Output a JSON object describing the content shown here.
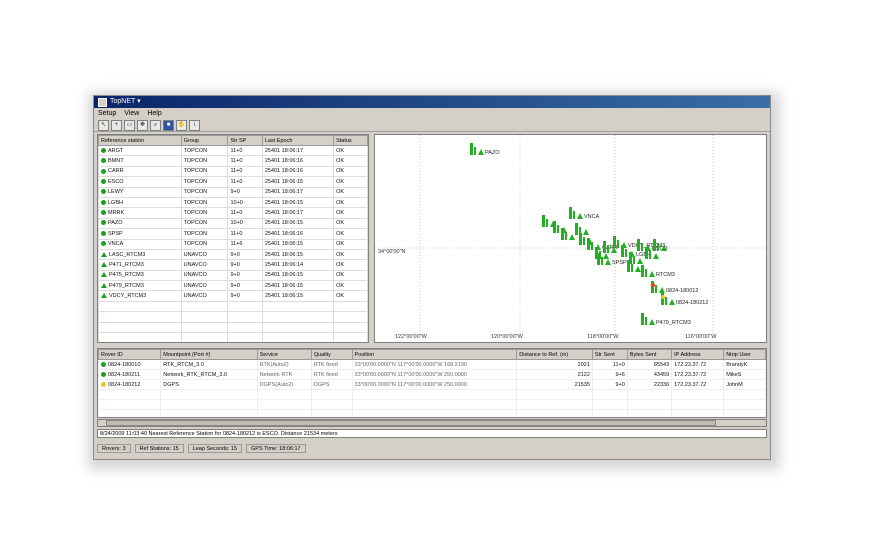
{
  "window": {
    "title": "TopNET ▾"
  },
  "menu": [
    "Setup",
    "View",
    "Help"
  ],
  "toolbar_icons": [
    "cursor-icon",
    "zoom-icon",
    "open-icon",
    "pan-icon",
    "search-icon",
    "save-icon",
    "hand-icon",
    "info-icon"
  ],
  "ref_table": {
    "columns": [
      "Reference station",
      "Group",
      "Str SP",
      "Last Epoch",
      "Status"
    ],
    "rows": [
      {
        "marker": "dot",
        "name": "ARGT",
        "group": "TOPCON",
        "sp": "11+0",
        "epoch": "25401 18:06:17",
        "status": "OK"
      },
      {
        "marker": "dot",
        "name": "BMNT",
        "group": "TOPCON",
        "sp": "11+0",
        "epoch": "25401 18:06:16",
        "status": "OK"
      },
      {
        "marker": "dot",
        "name": "CARR",
        "group": "TOPCON",
        "sp": "11+0",
        "epoch": "25401 18:06:16",
        "status": "OK"
      },
      {
        "marker": "dot",
        "name": "ESCO",
        "group": "TOPCON",
        "sp": "11+0",
        "epoch": "25401 18:06:15",
        "status": "OK"
      },
      {
        "marker": "dot",
        "name": "LEWY",
        "group": "TOPCON",
        "sp": "9+0",
        "epoch": "25401 18:06:17",
        "status": "OK"
      },
      {
        "marker": "dot",
        "name": "LGBH",
        "group": "TOPCON",
        "sp": "10+0",
        "epoch": "25401 18:06:15",
        "status": "OK"
      },
      {
        "marker": "dot",
        "name": "MRRK",
        "group": "TOPCON",
        "sp": "11+0",
        "epoch": "25401 18:06:17",
        "status": "OK"
      },
      {
        "marker": "dot",
        "name": "PAZO",
        "group": "TOPCON",
        "sp": "10+0",
        "epoch": "25401 18:06:15",
        "status": "OK"
      },
      {
        "marker": "dot",
        "name": "SPSP",
        "group": "TOPCON",
        "sp": "11+0",
        "epoch": "25401 18:06:16",
        "status": "OK"
      },
      {
        "marker": "dot",
        "name": "VNCA",
        "group": "TOPCON",
        "sp": "11+6",
        "epoch": "25401 18:06:15",
        "status": "OK"
      },
      {
        "marker": "tri",
        "name": "LASC_RTCM3",
        "group": "UNAVCO",
        "sp": "9+0",
        "epoch": "25401 18:06:15",
        "status": "OK"
      },
      {
        "marker": "tri",
        "name": "P471_RTCM3",
        "group": "UNAVCO",
        "sp": "9+0",
        "epoch": "25401 18:06:14",
        "status": "OK"
      },
      {
        "marker": "tri",
        "name": "P475_RTCM3",
        "group": "UNAVCO",
        "sp": "9+0",
        "epoch": "25401 18:06:15",
        "status": "OK"
      },
      {
        "marker": "tri",
        "name": "P479_RTCM3",
        "group": "UNAVCO",
        "sp": "9+0",
        "epoch": "25401 18:06:15",
        "status": "OK"
      },
      {
        "marker": "tri",
        "name": "VDCY_RTCM3",
        "group": "UNAVCO",
        "sp": "9+0",
        "epoch": "25401 18:06:15",
        "status": "OK"
      }
    ],
    "empty_rows": 5
  },
  "map": {
    "lat_label": "34°00'00\"N",
    "lon_labels": [
      "122°00'00\"W",
      "120°00'00\"W",
      "118°00'00\"W",
      "116°00'00\"W"
    ],
    "station_labels": [
      "PAZO",
      "VNCA",
      "VDCY_RTCM3",
      "CARR",
      "LGBH",
      "ESCO",
      "RTCM3",
      "0824-180012",
      "0824-180212",
      "P479_RTCM3",
      "SPSP"
    ]
  },
  "rover_table": {
    "columns": [
      "Rover ID",
      "Mountpoint (Port #)",
      "Service",
      "Quality",
      "Position",
      "Distance to Ref. (m)",
      "Str Sent",
      "Bytes Sent",
      "IP Address",
      "Ntrip User"
    ],
    "rows": [
      {
        "marker": "dot",
        "id": "0824-180010",
        "mount": "RTK_RTCM_3.0",
        "service": "RTK(Auto2)",
        "quality": "RTK fixed",
        "position": "33°00'00.0000\"N  117°00'00.0000\"W 168.2190",
        "distance": "2021",
        "str": "11+0",
        "bytes": "85543",
        "ip": "172.23.37.72",
        "user": "BrandyK"
      },
      {
        "marker": "dot",
        "id": "0824-180211",
        "mount": "Network_RTK_RTCM_3.0",
        "service": "Network RTK",
        "quality": "RTK fixed",
        "position": "33°00'00.0000\"N  117°00'00.0000\"W 250.0000",
        "distance": "2122",
        "str": "9+6",
        "bytes": "43459",
        "ip": "172.23.37.72",
        "user": "MikeS"
      },
      {
        "marker": "yellow",
        "id": "0824-180212",
        "mount": "DGPS",
        "service": "DGPS(Auto2)",
        "quality": "DGPS",
        "position": "33°00'00.0000\"N  117°00'00.0000\"W 250.0000",
        "distance": "21535",
        "str": "9+0",
        "bytes": "22336",
        "ip": "172.23.37.72",
        "user": "JohnM"
      }
    ],
    "empty_rows": 3
  },
  "message": "8/24/2009 11:03:40 Nearest Reference Station for 0824-180212 is ESCO. Distance 21534 meters",
  "status": {
    "rovers": "Rovers: 3",
    "ref_stations": "Ref Stations: 15",
    "leap_seconds": "Leap Seconds: 15",
    "gps_time": "GPS Time: 18:06:17"
  }
}
